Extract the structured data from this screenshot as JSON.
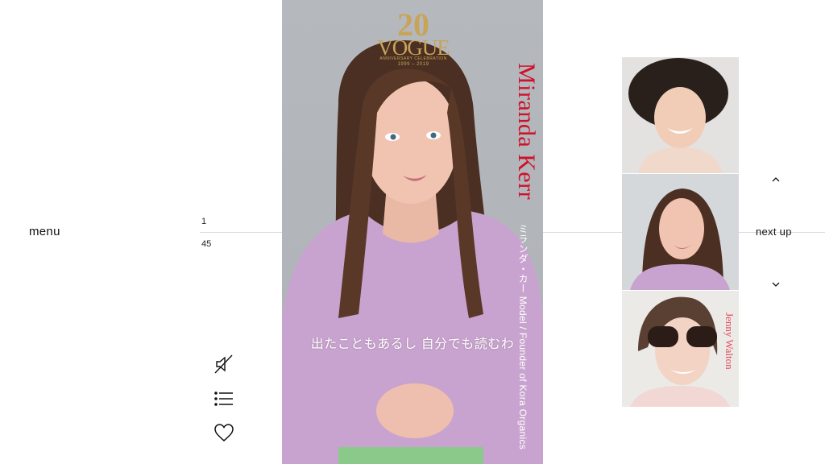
{
  "nav": {
    "menu_label": "menu"
  },
  "counter": {
    "current": "1",
    "total": "45"
  },
  "sidebar_icons": [
    "mute-icon",
    "list-icon",
    "heart-icon"
  ],
  "video": {
    "logo": {
      "number": "20",
      "word": "VOGUE",
      "tagline": "ANNIVERSARY CELEBRATION",
      "years": "1999 – 2019"
    },
    "person_name": "Miranda Kerr",
    "person_role": "ミランダ・カー Model / Founder of Kora Organics",
    "subtitle": "出たこともあるし  自分でも読むわ"
  },
  "next_up": {
    "label": "next up",
    "thumbnails": [
      {
        "name": ""
      },
      {
        "name": ""
      },
      {
        "name": "Jenny Walton"
      }
    ]
  },
  "colors": {
    "name_red": "#d0102a",
    "logo_gold": "#c8a45a",
    "thumb_name": "#e24b5a"
  }
}
